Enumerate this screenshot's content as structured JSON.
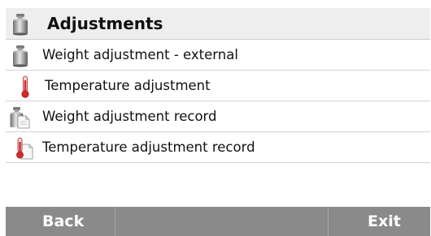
{
  "header": {
    "title": "Adjustments",
    "icon": "weight-icon"
  },
  "menu": {
    "items": [
      {
        "label": "Weight adjustment - external",
        "icon": "weight-icon"
      },
      {
        "label": "Temperature adjustment",
        "icon": "thermometer-icon"
      },
      {
        "label": "Weight adjustment record",
        "icon": "weight-record-icon"
      },
      {
        "label": "Temperature adjustment record",
        "icon": "thermometer-record-icon"
      }
    ]
  },
  "softkeys": {
    "back_label": "Back",
    "middle_label": "",
    "exit_label": "Exit"
  },
  "colors": {
    "header_background": "#eeeeee",
    "footer_background": "#8a8a8a",
    "thermometer_red": "#d32a2a",
    "weight_gray": "#8f8f8f"
  }
}
